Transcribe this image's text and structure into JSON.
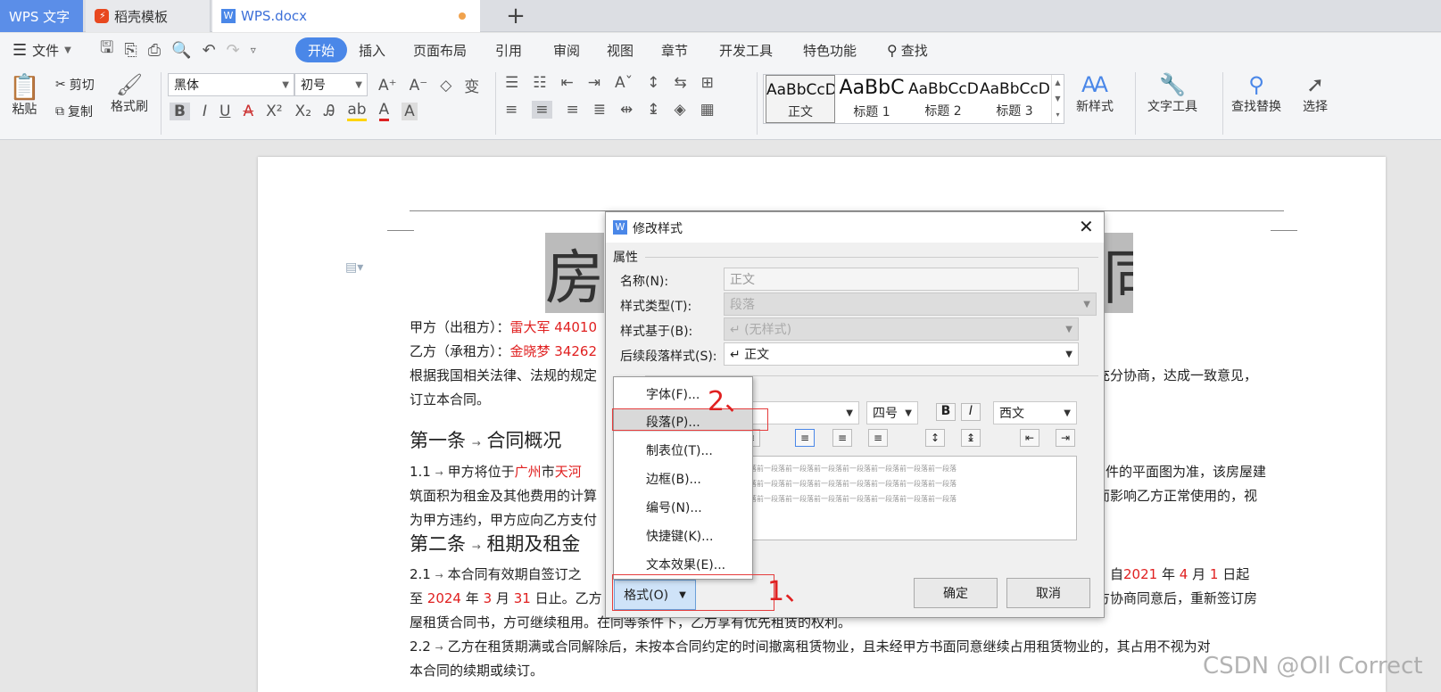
{
  "tabs": {
    "wps": "WPS 文字",
    "daoke": "稻壳模板",
    "doc": "WPS.docx",
    "new": "+"
  },
  "menu": {
    "file": "文件",
    "items": [
      "开始",
      "插入",
      "页面布局",
      "引用",
      "审阅",
      "视图",
      "章节",
      "开发工具",
      "特色功能",
      "查找"
    ]
  },
  "ribbon": {
    "paste": "粘贴",
    "cut": "剪切",
    "copy": "复制",
    "format_painter": "格式刷",
    "font_name": "黑体",
    "font_size": "初号",
    "styles": [
      {
        "preview": "AaBbCcD",
        "name": "正文"
      },
      {
        "preview": "AaBbC",
        "name": "标题 1"
      },
      {
        "preview": "AaBbCcD",
        "name": "标题 2"
      },
      {
        "preview": "AaBbCcD",
        "name": "标题 3"
      }
    ],
    "new_style": "新样式",
    "text_tools": "文字工具",
    "find_replace": "查找替换",
    "select": "选择"
  },
  "doc": {
    "title_left": "房",
    "title_right": "同",
    "line1_label": "甲方（出租方）：",
    "line1_value": "雷大军 44010",
    "line2_label": "乙方（承租方）：",
    "line2_value": "金晓梦 34262",
    "line3_left": "根据我国相关法律、法规的规定",
    "line3_right": "充分协商，达成一致意见，",
    "line4": "订立本合同。",
    "art1": "第一条",
    "art1_title": "合同概况",
    "p11_num": "1.1",
    "p11_a": "甲方将位于",
    "p11_city": "广州",
    "p11_b": "市",
    "p11_dist": "天河",
    "p11_right": "件的平面图为准，该房屋建",
    "p11_l2_left": "筑面积为租金及其他费用的计算",
    "p11_l2_right": "而影响乙方正常使用的，视",
    "p11_l3": "为甲方违约，甲方应向乙方支付",
    "art2": "第二条",
    "art2_title": "租期及租金",
    "p21_num": "2.1",
    "p21_a": "本合同有效期自签订之",
    "p21_r1": "年：自",
    "p21_y1": "2021",
    "p21_r2": "年",
    "p21_m1": "4",
    "p21_r3": "月",
    "p21_d1": "1",
    "p21_r4": "日起",
    "p21_l2a": "至",
    "p21_y2": "2024",
    "p21_l2b": "年",
    "p21_m2": "3",
    "p21_l2c": "月",
    "p21_d2": "31",
    "p21_l2d": "日止。乙方",
    "p21_l2_right": "方协商同意后，重新签订房",
    "p21_l3": "屋租赁合同书，方可继续租用。在同等条件下，乙方享有优先租赁的权利。",
    "p22_num": "2.2",
    "p22": "乙方在租赁期满或合同解除后，未按本合同约定的时间撤离租赁物业，且未经甲方书面同意继续占用租赁物业的，其占用不视为对",
    "p22_l2": "本合同的续期或续订。"
  },
  "dialog": {
    "title": "修改样式",
    "section": "属性",
    "name_label": "名称(N):",
    "name_value": "正文",
    "type_label": "样式类型(T):",
    "type_value": "段落",
    "based_label": "样式基于(B):",
    "based_value": "↵ (无样式)",
    "next_label": "后续段落样式(S):",
    "next_value": "↵ 正文",
    "size_value": "四号",
    "lang_value": "西文",
    "preview_line": "段落前一段落前一段落前一段落前一段落前一段落前一段落前一段落",
    "format_button": "格式(O)",
    "ok": "确定",
    "cancel": "取消"
  },
  "popup": [
    "字体(F)...",
    "段落(P)...",
    "制表位(T)...",
    "边框(B)...",
    "编号(N)...",
    "快捷键(K)...",
    "文本效果(E)..."
  ],
  "annotations": {
    "one": "1、",
    "two": "2、"
  },
  "watermark": "CSDN @Oll Correct",
  "colors": {
    "accent": "#4a87e8",
    "red": "#e02020",
    "tab_blue": "#5b8ee8"
  }
}
